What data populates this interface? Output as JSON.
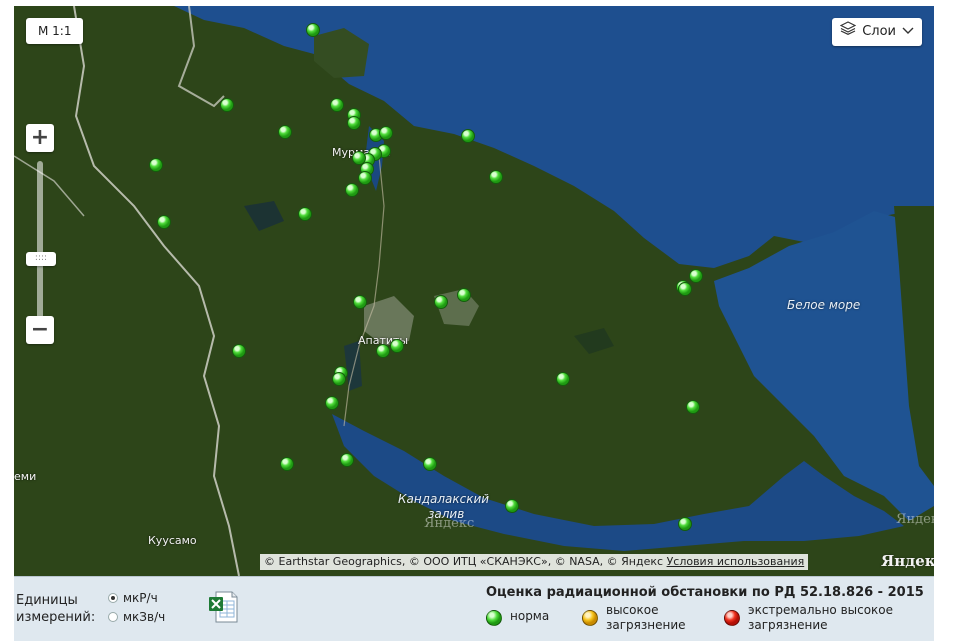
{
  "map": {
    "scale_label": "М 1:1",
    "layers_label": "Слои",
    "zoom_in_label": "+",
    "zoom_out_label": "−",
    "zoom_thumb_label": "::::",
    "place_labels": {
      "murmansk": "Мурманск",
      "apatity": "Апатиты",
      "white_sea": "Белое море",
      "kandalaksha_1": "Кандалакский",
      "kandalaksha_2": "залив",
      "kuusamo": "Куусамо",
      "edge": "еми"
    },
    "copyright": "© Earthstar Geographics, © ООО ИТЦ «СКАНЭКС», © NASA, © Яндекс",
    "terms_link": "Условия использования",
    "yandex_logo": "Яндекс",
    "colors": {
      "sea": "#1e4e8e",
      "land": "#2c4417",
      "marker_norm": "#39c21f"
    }
  },
  "footer": {
    "units_label_line1": "Единицы",
    "units_label_line2": "измерений:",
    "unit_options": [
      "мкР/ч",
      "мкЗв/ч"
    ],
    "selected_unit": "мкР/ч",
    "export_icon": "excel-icon",
    "legend_title": "Оценка радиационной обстановки по РД 52.18.826 - 2015",
    "legend": [
      {
        "line1": "норма",
        "line2": "",
        "color": "#2fbf1f"
      },
      {
        "line1": "высокое",
        "line2": "загрязнение",
        "color": "#f0b400"
      },
      {
        "line1": "экстремально высокое",
        "line2": "загрязнение",
        "color": "#e51a10"
      }
    ]
  }
}
